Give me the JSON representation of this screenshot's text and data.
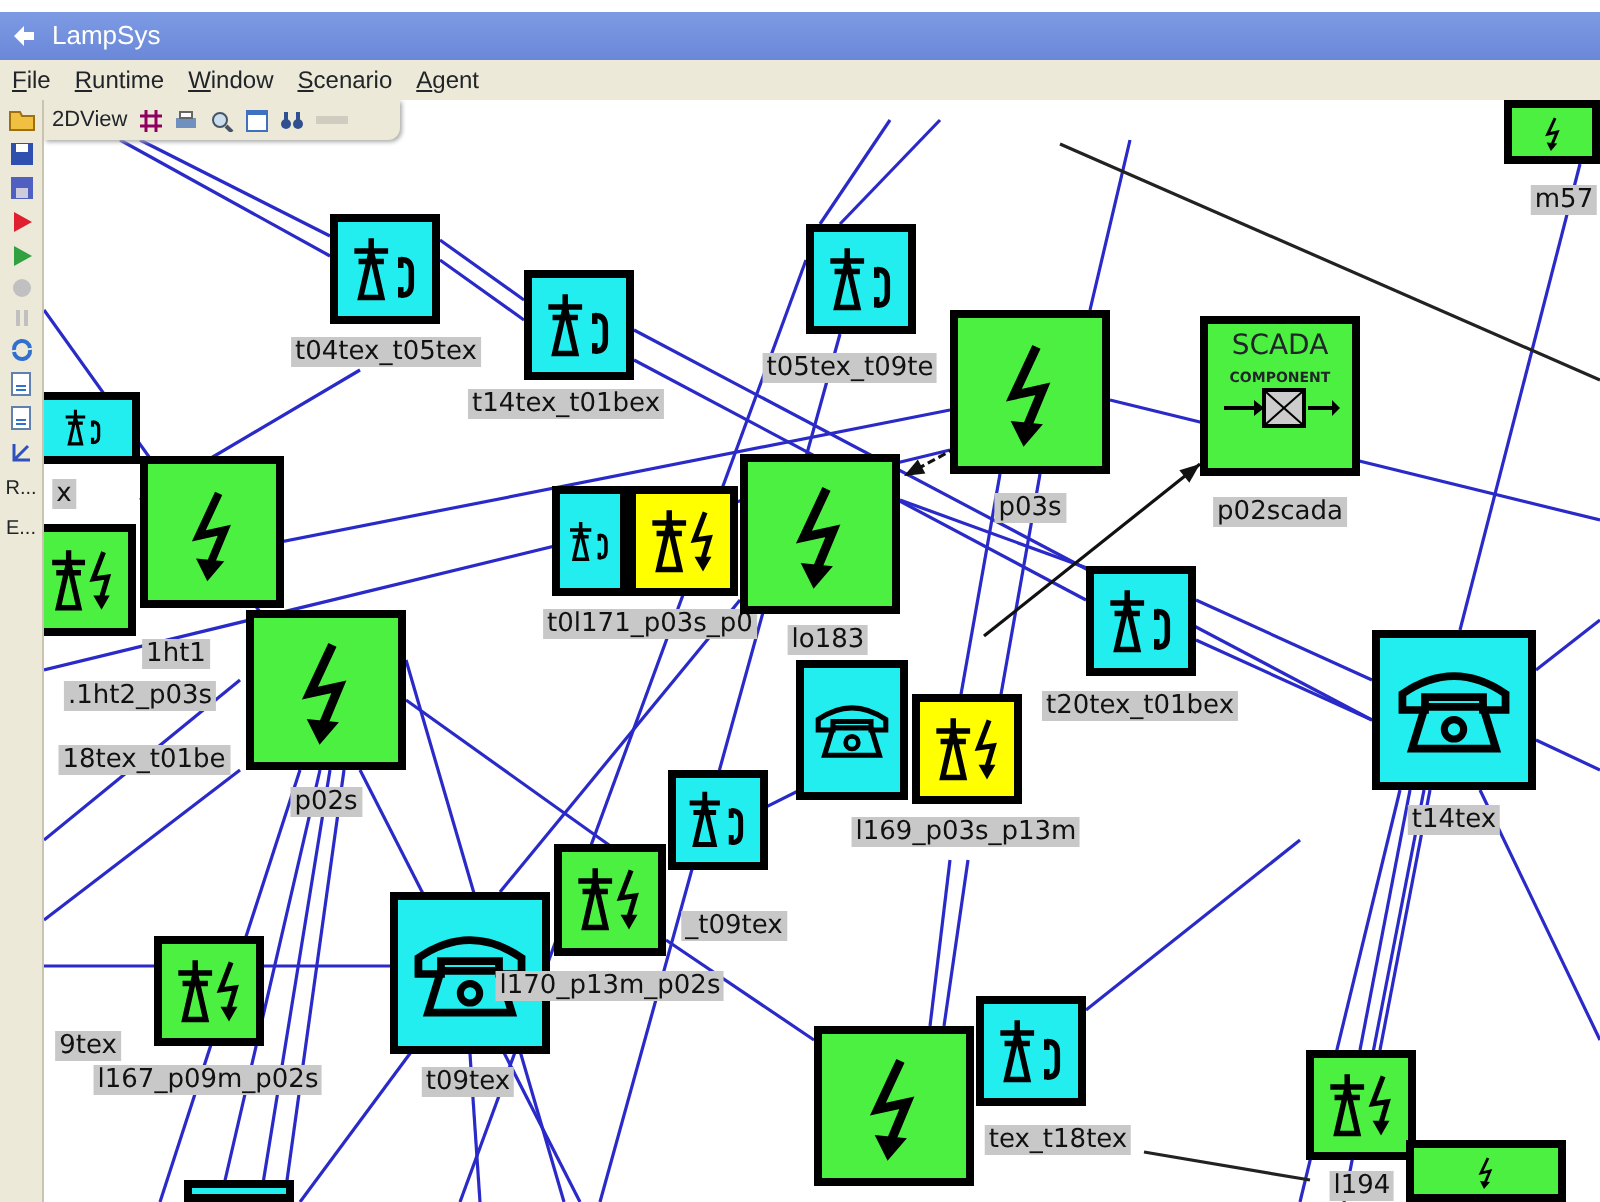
{
  "window": {
    "title": "LampSys"
  },
  "menu": [
    "File",
    "Runtime",
    "Window",
    "Scenario",
    "Agent"
  ],
  "view_toolbar": {
    "title": "2DView"
  },
  "side_toolbar": {
    "labels": [
      "R...",
      "E..."
    ]
  },
  "nodes": [
    {
      "kind": "tower-phone",
      "color": "#22eef0",
      "label": "t04tex_t05tex"
    },
    {
      "kind": "tower-phone",
      "color": "#22eef0",
      "label": "t14tex_t01bex"
    },
    {
      "kind": "tower-phone",
      "color": "#22eef0",
      "label": "t05tex_t09te"
    },
    {
      "kind": "power",
      "color": "#4cf040",
      "label": "p03s"
    },
    {
      "kind": "scada",
      "color": "#4cf040",
      "label": "p02scada",
      "title": "SCADA",
      "subtitle": "COMPONENT"
    },
    {
      "kind": "power",
      "color": "#4cf040",
      "label": "m57"
    },
    {
      "kind": "tower-phone",
      "color": "#22eef0",
      "label": "x"
    },
    {
      "kind": "power",
      "color": "#4cf040",
      "label": "1ht1"
    },
    {
      "kind": "tower-power",
      "color": "#4cf040",
      "label": ".1ht2_p03s"
    },
    {
      "kind": "label",
      "label": "18tex_t01be"
    },
    {
      "kind": "power",
      "color": "#4cf040",
      "label": "p02s"
    },
    {
      "kind": "tower-phone",
      "color": "#22eef0"
    },
    {
      "kind": "tower-power",
      "color": "#ffff00",
      "label": "t0l171_p03s_p0"
    },
    {
      "kind": "power",
      "color": "#4cf040",
      "label": "lo183"
    },
    {
      "kind": "tower-phone",
      "color": "#22eef0",
      "label": "t20tex_t01bex"
    },
    {
      "kind": "phone",
      "color": "#22eef0",
      "label": "t14tex"
    },
    {
      "kind": "phone",
      "color": "#22eef0"
    },
    {
      "kind": "tower-power",
      "color": "#ffff00",
      "label": "l169_p03s_p13m"
    },
    {
      "kind": "tower-phone",
      "color": "#22eef0"
    },
    {
      "kind": "tower-power",
      "color": "#4cf040",
      "label": "_t09tex"
    },
    {
      "kind": "phone",
      "color": "#22eef0",
      "label": "t09tex"
    },
    {
      "kind": "label",
      "label": "l170_p13m_p02s"
    },
    {
      "kind": "tower-power",
      "color": "#4cf040",
      "label": "l167_p09m_p02s"
    },
    {
      "kind": "label",
      "label": "9tex"
    },
    {
      "kind": "power",
      "color": "#4cf040"
    },
    {
      "kind": "tower-phone",
      "color": "#22eef0",
      "label": "tex_t18tex"
    },
    {
      "kind": "tower-power",
      "color": "#4cf040",
      "label": "l194"
    },
    {
      "kind": "power",
      "color": "#4cf040"
    },
    {
      "kind": "tower-phone",
      "color": "#22eef0"
    }
  ]
}
